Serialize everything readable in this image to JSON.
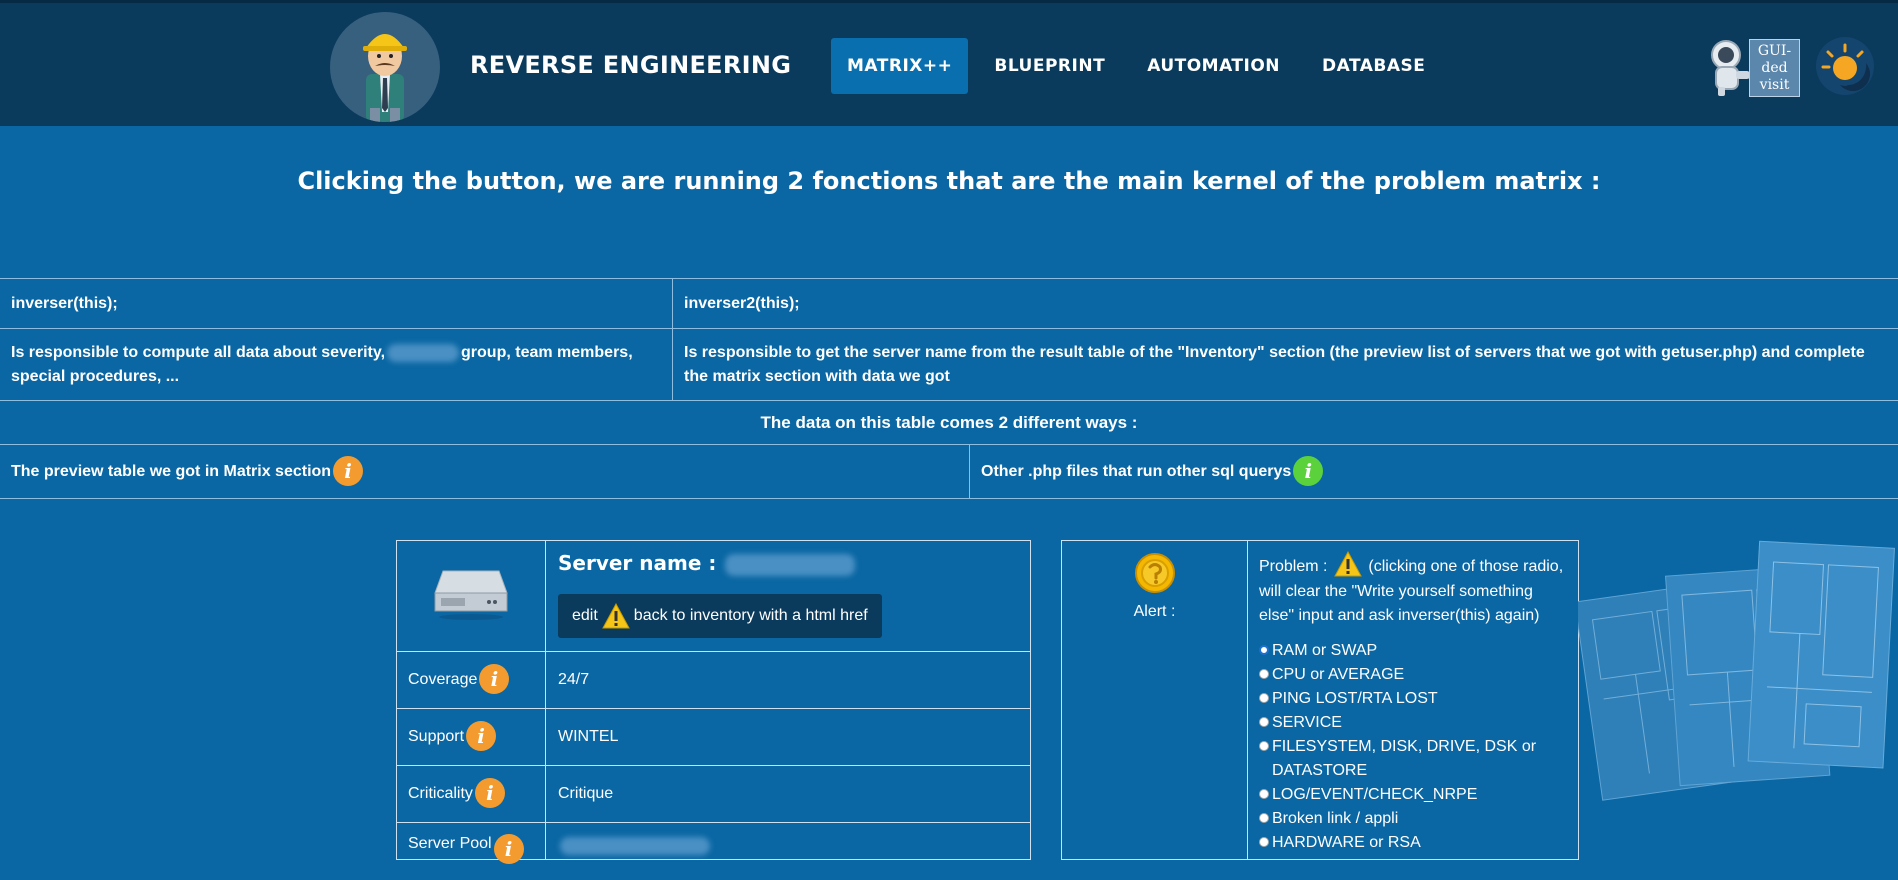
{
  "header": {
    "brand": "REVERSE ENGINEERING",
    "nav": [
      {
        "label": "MATRIX++",
        "active": true
      },
      {
        "label": "BLUEPRINT",
        "active": false
      },
      {
        "label": "AUTOMATION",
        "active": false
      },
      {
        "label": "DATABASE",
        "active": false
      }
    ],
    "guided_visit": [
      "GUI-",
      "ded",
      "visit"
    ]
  },
  "headline": "Clicking the button, we are running 2 fonctions that are the main kernel of the problem matrix :",
  "functions": {
    "f1_name": "inverser(this);",
    "f2_name": "inverser2(this);",
    "f1_desc_a": "Is responsible to compute all data about severity,",
    "f1_desc_b": "group, team members, special procedures, ...",
    "f2_desc": "Is responsible to get the server name from the result table of the \"Inventory\" section (the preview list of servers that we got with getuser.php) and complete the matrix section with data we got"
  },
  "data_sources": {
    "title": "The data on this table comes 2 different ways :",
    "left": "The preview table we got in Matrix section",
    "right": "Other .php files that run other sql querys"
  },
  "server": {
    "name_label": "Server name :",
    "edit_text_a": "edit",
    "edit_text_b": "back to inventory with a html href",
    "rows": [
      {
        "label": "Coverage",
        "value": "24/7"
      },
      {
        "label": "Support",
        "value": "WINTEL"
      },
      {
        "label": "Criticality",
        "value": "Critique"
      },
      {
        "label": "Server Pool",
        "value": ""
      }
    ]
  },
  "alert": {
    "label": "Alert :",
    "problem_a": "Problem :",
    "problem_b": "(clicking one of those radio, will clear the \"Write yourself something else\" input and ask inverser(this) again)",
    "options": [
      "RAM or SWAP",
      "CPU or AVERAGE",
      "PING LOST/RTA LOST",
      "SERVICE",
      "FILESYSTEM, DISK, DRIVE, DSK or DATASTORE",
      "LOG/EVENT/CHECK_NRPE",
      "Broken link / appli",
      "HARDWARE or RSA"
    ],
    "selected_index": 0
  },
  "colors": {
    "page_bg": "#0a67a3",
    "header_bg": "#0a3a5c",
    "info_orange": "#f39b2f",
    "info_green": "#5bd23c"
  }
}
